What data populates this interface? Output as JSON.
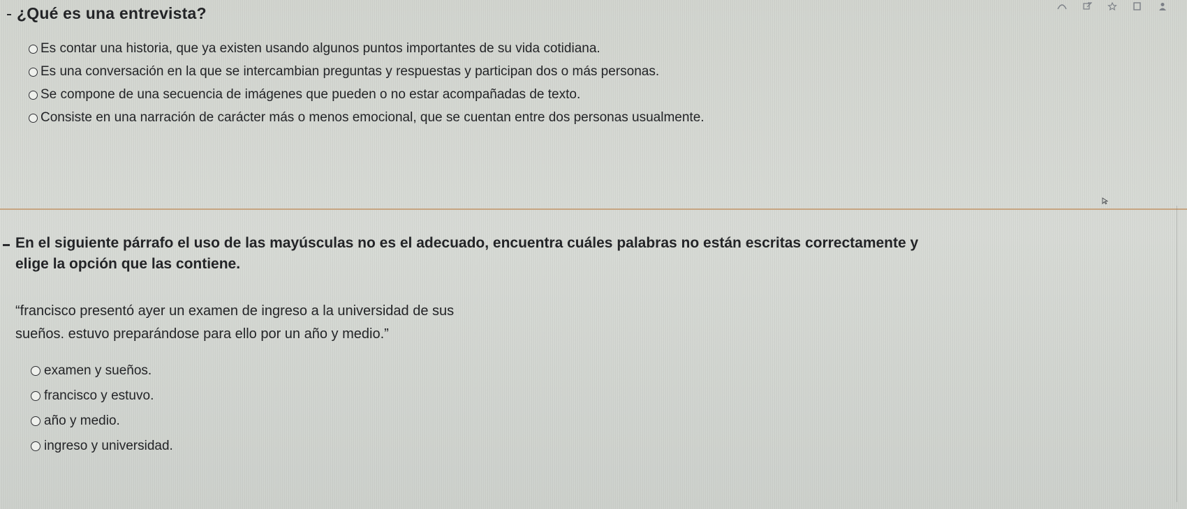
{
  "question1": {
    "title": "¿Qué es una entrevista?",
    "options": [
      "Es contar una historia, que ya existen usando algunos puntos importantes de su vida cotidiana.",
      "Es una conversación en la que se intercambian preguntas y respuestas y participan dos o más personas.",
      "Se compone de una secuencia de imágenes que pueden o no estar acompañadas de texto.",
      "Consiste en una narración de carácter más o menos emocional, que se cuentan entre dos personas usualmente."
    ]
  },
  "question2": {
    "title_line1": "En el siguiente párrafo el uso de las mayúsculas no es el adecuado, encuentra cuáles palabras no están escritas correctamente y",
    "title_line2": "elige la opción que las contiene.",
    "quote_line1": "“francisco presentó ayer un examen de ingreso a la universidad de sus",
    "quote_line2": "sueños. estuvo preparándose para ello por un año y medio.”",
    "options": [
      "examen y sueños.",
      "francisco y estuvo.",
      "año y medio.",
      "ingreso y universidad."
    ]
  },
  "toolbar": {
    "icons": [
      "curve-icon",
      "edit-icon",
      "star-icon",
      "square-icon",
      "person-icon"
    ]
  },
  "colors": {
    "background": "#d5d8d3",
    "text": "#232427",
    "separator": "#c6a582"
  }
}
